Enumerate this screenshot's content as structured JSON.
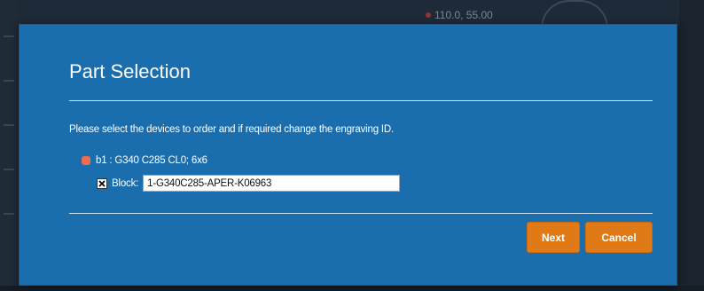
{
  "background": {
    "readout": "110.0, 55.00",
    "accent": "#a33333"
  },
  "dialog": {
    "title": "Part Selection",
    "instruction": "Please select the devices to order and if required change the engraving ID.",
    "device": {
      "label": "b1 :  G340 C285 CL0; 6x6",
      "status_color": "#ee6d4f"
    },
    "block": {
      "checked": true,
      "label": "Block:",
      "value": "1-G340C285-APER-K06963"
    },
    "buttons": {
      "next": "Next",
      "cancel": "Cancel"
    },
    "colors": {
      "panel": "#1b6ead",
      "button": "#e07a17"
    }
  }
}
